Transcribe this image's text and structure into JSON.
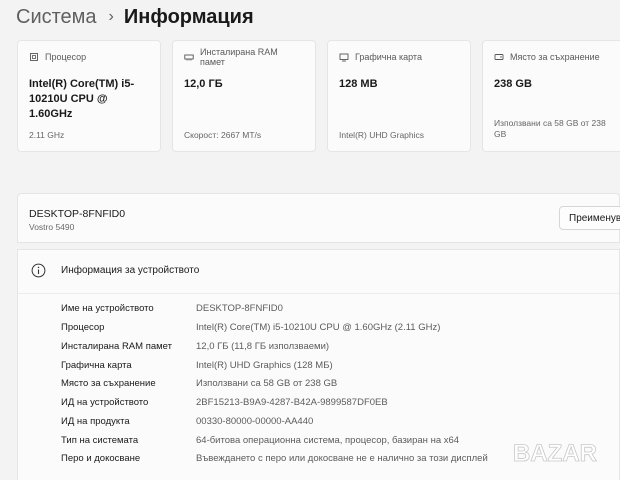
{
  "breadcrumb": {
    "parent": "Система",
    "separator": "›",
    "current": "Информация"
  },
  "cards": [
    {
      "icon": "processor-icon",
      "title": "Процесор",
      "value": "Intel(R) Core(TM) i5-10210U CPU @ 1.60GHz",
      "sub": "2.11 GHz"
    },
    {
      "icon": "ram-icon",
      "title": "Инсталирана RAM памет",
      "value": "12,0 ГБ",
      "sub": "Скорост: 2667 MT/s"
    },
    {
      "icon": "graphics-card-icon",
      "title": "Графична карта",
      "value": "128 MB",
      "sub": "Intel(R) UHD Graphics"
    },
    {
      "icon": "storage-icon",
      "title": "Място за съхранение",
      "value": "238 GB",
      "sub": "Използвани са 58 GB от 238 GB"
    }
  ],
  "device": {
    "name": "DESKTOP-8FNFID0",
    "model": "Vostro 5490",
    "rename_label": "Преименуване на този компютър"
  },
  "specs": {
    "title": "Информация за устройството",
    "rows": [
      {
        "label": "Име на устройството",
        "value": "DESKTOP-8FNFID0"
      },
      {
        "label": "Процесор",
        "value": "Intel(R) Core(TM) i5-10210U CPU @ 1.60GHz (2.11 GHz)"
      },
      {
        "label": "Инсталирана RAM памет",
        "value": "12,0 ГБ (11,8 ГБ използваеми)"
      },
      {
        "label": "Графична карта",
        "value": "Intel(R) UHD Graphics (128 МБ)"
      },
      {
        "label": "Място за съхранение",
        "value": "Използвани са 58 GB от 238 GB"
      },
      {
        "label": "ИД на устройството",
        "value": "2BF15213-B9A9-4287-B42A-9899587DF0EB"
      },
      {
        "label": "ИД на продукта",
        "value": "00330-80000-00000-AA440"
      },
      {
        "label": "Тип на системата",
        "value": "64-битова операционна система, процесор, базиран на x64"
      },
      {
        "label": "Перо и докосване",
        "value": "Въвеждането с перо или докосване не е налично за този дисплей"
      }
    ]
  },
  "watermark": "BAZAR",
  "colors": {
    "background": "#f3f3f3",
    "card": "#fbfbfb",
    "border": "#e5e5e5",
    "secondary_text": "#5c5c5c"
  }
}
